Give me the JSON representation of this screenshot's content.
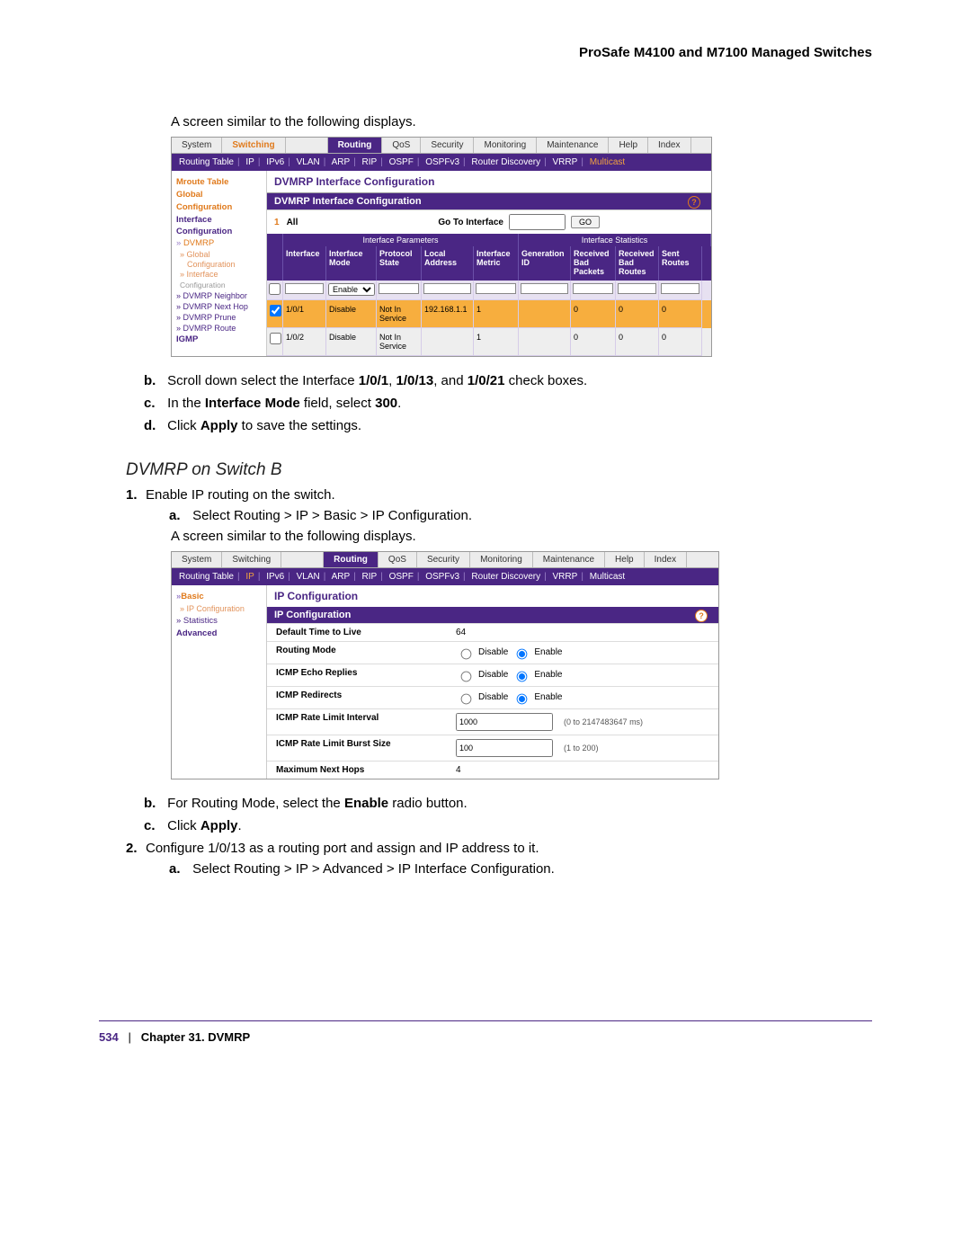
{
  "header": {
    "title": "ProSafe M4100 and M7100 Managed Switches"
  },
  "intro1": "A screen similar to the following displays.",
  "nav": {
    "tabs": [
      "System",
      "Switching",
      "",
      "Routing",
      "QoS",
      "Security",
      "Monitoring",
      "Maintenance",
      "Help",
      "Index"
    ],
    "subnav": [
      "Routing Table",
      "IP",
      "IPv6",
      "VLAN",
      "ARP",
      "RIP",
      "OSPF",
      "OSPFv3",
      "Router Discovery",
      "VRRP",
      "Multicast"
    ]
  },
  "shotA": {
    "title": "DVMRP Interface Configuration",
    "section": "DVMRP Interface Configuration",
    "sidebar": {
      "mroute": "Mroute Table",
      "global": "Global",
      "conf": "Configuration",
      "iface": "Interface",
      "dvmrp": "DVMRP",
      "sub_global": "» Global",
      "sub_conf": "Configuration",
      "sub_iface": "» Interface",
      "sub_conf2": "Configuration",
      "n1": "» DVMRP Neighbor",
      "n2": "» DVMRP Next Hop",
      "n3": "» DVMRP Prune",
      "n4": "» DVMRP Route",
      "igmp": "IGMP"
    },
    "all_row": {
      "one": "1",
      "all": "All",
      "goto": "Go To Interface",
      "go": "GO"
    },
    "group1": "Interface Parameters",
    "group2": "Interface Statistics",
    "headers": {
      "if": "Interface",
      "mode": "Interface Mode",
      "ps": "Protocol State",
      "addr": "Local Address",
      "met": "Interface Metric",
      "gen": "Generation ID",
      "rx": "Received Bad Packets",
      "rxr": "Received Bad Routes",
      "rts": "Sent Routes"
    },
    "mode_option": "Enable",
    "rows": [
      {
        "checked": true,
        "if": "1/0/1",
        "mode": "Disable",
        "ps": "Not In Service",
        "addr": "192.168.1.1",
        "met": "1",
        "gen": "",
        "rx": "0",
        "rxr": "0",
        "rts": "0"
      },
      {
        "checked": false,
        "if": "1/0/2",
        "mode": "Disable",
        "ps": "Not In Service",
        "addr": "",
        "met": "1",
        "gen": "",
        "rx": "0",
        "rxr": "0",
        "rts": "0"
      }
    ]
  },
  "listA": {
    "b": {
      "pre": "Scroll down select the Interface ",
      "b1": "1/0/1",
      "m1": ", ",
      "b2": "1/0/13",
      "m2": ", and ",
      "b3": "1/0/21",
      "post": " check boxes."
    },
    "c": {
      "pre": "In the ",
      "b": "Interface Mode",
      "mid": " field, select ",
      "val": "300",
      "post": "."
    },
    "d": {
      "pre": "Click ",
      "b": "Apply",
      "post": " to save the settings."
    }
  },
  "section_head": "DVMRP on Switch B",
  "num1": "Enable IP routing on the switch.",
  "sub1a": {
    "pre": "Select ",
    "b": "Routing > IP > Basic > IP Configuration",
    "post": "."
  },
  "intro2": "A screen similar to the following displays.",
  "shotB": {
    "title": "IP Configuration",
    "section": "IP Configuration",
    "sidebar": {
      "basic": "Basic",
      "ipconf": "» IP Configuration",
      "stats": "» Statistics",
      "adv": "Advanced"
    },
    "kv": [
      {
        "k": "Default Time to Live",
        "v": "64"
      },
      {
        "k": "Routing Mode",
        "r1": "Disable",
        "r2": "Enable",
        "sel": 2
      },
      {
        "k": "ICMP Echo Replies",
        "r1": "Disable",
        "r2": "Enable",
        "sel": 2
      },
      {
        "k": "ICMP Redirects",
        "r1": "Disable",
        "r2": "Enable",
        "sel": 2
      },
      {
        "k": "ICMP Rate Limit Interval",
        "input": "1000",
        "hint": "(0 to 2147483647 ms)"
      },
      {
        "k": "ICMP Rate Limit Burst Size",
        "input": "100",
        "hint": "(1 to 200)"
      },
      {
        "k": "Maximum Next Hops",
        "v": "4"
      }
    ]
  },
  "listB": {
    "b": {
      "pre": "For Routing Mode, select the ",
      "b": "Enable",
      "post": " radio button."
    },
    "c": {
      "pre": "Click ",
      "b": "Apply",
      "post": "."
    }
  },
  "num2": "Configure 1/0/13 as a routing port and assign and IP address to it.",
  "sub2a": {
    "pre": "Select ",
    "b": "Routing > IP > Advanced > IP Interface Configuration",
    "post": "."
  },
  "footer": {
    "page": "534",
    "sep": "|",
    "chap": "Chapter 31.  DVMRP"
  }
}
